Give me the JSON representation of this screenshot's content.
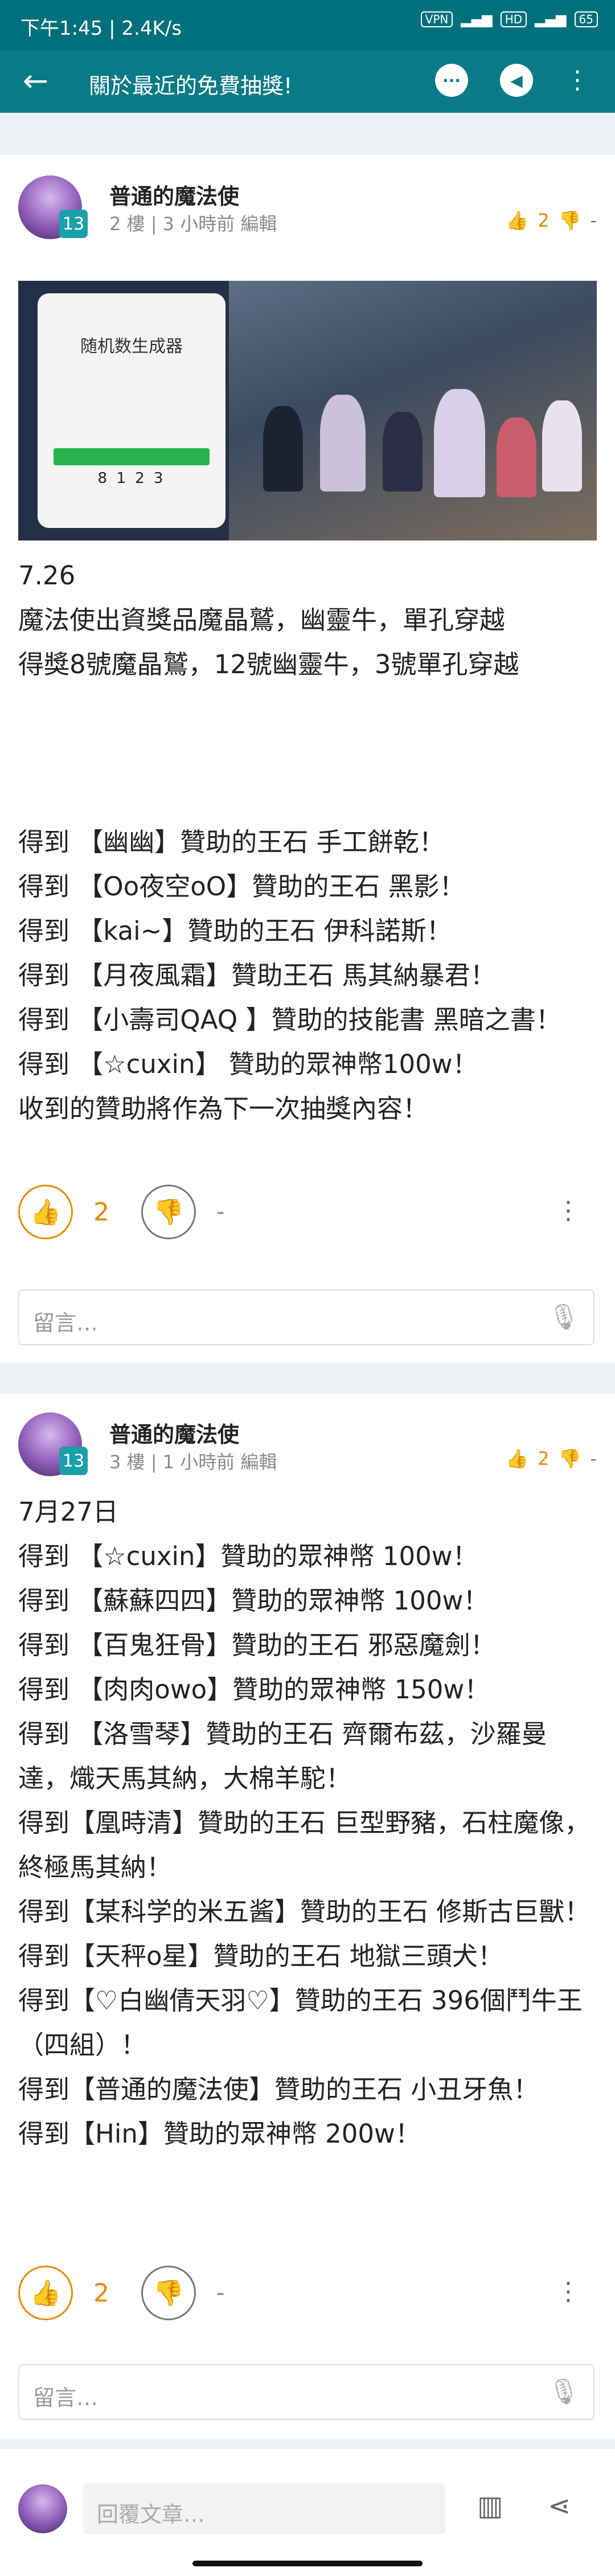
{
  "status": {
    "time_speed": "下午1:45 | 2.4K/s",
    "vpn": "VPN",
    "hd": "HD",
    "battery": "65"
  },
  "appbar": {
    "title": "關於最近的免費抽獎!"
  },
  "post1": {
    "username": "普通的魔法使",
    "level": "13",
    "meta": "2 樓 | 3 小時前 編輯",
    "good": "2",
    "bad": "-",
    "screenshot": {
      "app_title": "随机数生成器",
      "result": "8 1 2 3"
    },
    "lines": [
      "7.26",
      "魔法使出資獎品魔晶鷲，幽靈牛，單孔穿越",
      "得獎8號魔晶鷲，12號幽靈牛，3號單孔穿越",
      "",
      "",
      "",
      "得到 【幽幽】贊助的王石 手工餅乾！",
      "得到 【Oo夜空oO】贊助的王石 黑影！",
      "得到 【kai~】贊助的王石 伊科諾斯！",
      "得到 【月夜風霜】贊助王石 馬其納暴君！",
      "得到 【小壽司QAQ 】贊助的技能書 黑暗之書！",
      "得到 【☆cuxin】 贊助的眾神幣100w！",
      "收到的贊助將作為下一次抽獎內容！"
    ]
  },
  "post2": {
    "username": "普通的魔法使",
    "level": "13",
    "meta": "3 樓 | 1 小時前 編輯",
    "good": "2",
    "bad": "-",
    "lines": [
      "7月27日",
      "得到 【☆cuxin】贊助的眾神幣 100w！",
      "得到 【蘇蘇四四】贊助的眾神幣 100w！",
      "得到 【百鬼狂骨】贊助的王石 邪惡魔劍！",
      "得到 【肉肉owo】贊助的眾神幣 150w！",
      "得到 【洛雪琴】贊助的王石 齊爾布茲，沙羅曼達，熾天馬其納，大棉羊駝！",
      "得到【凰時清】贊助的王石 巨型野豬，石柱魔像，終極馬其納！",
      "得到【某科学的米五酱】贊助的王石 修斯古巨獸！",
      "得到【天秤o星】贊助的王石 地獄三頭犬！",
      "得到【♡白幽倩天羽♡】贊助的王石 396個鬥牛王（四組）！",
      "得到【普通的魔法使】贊助的王石 小丑牙魚！",
      "得到【Hin】贊助的眾神幣 200w！"
    ]
  },
  "comment": {
    "placeholder": "留言…"
  },
  "bottom": {
    "reply_placeholder": "回覆文章…"
  },
  "colors": {
    "teal": "#0a7a86",
    "gp": "#e28b00",
    "level_badge": "#1aa0a8"
  }
}
